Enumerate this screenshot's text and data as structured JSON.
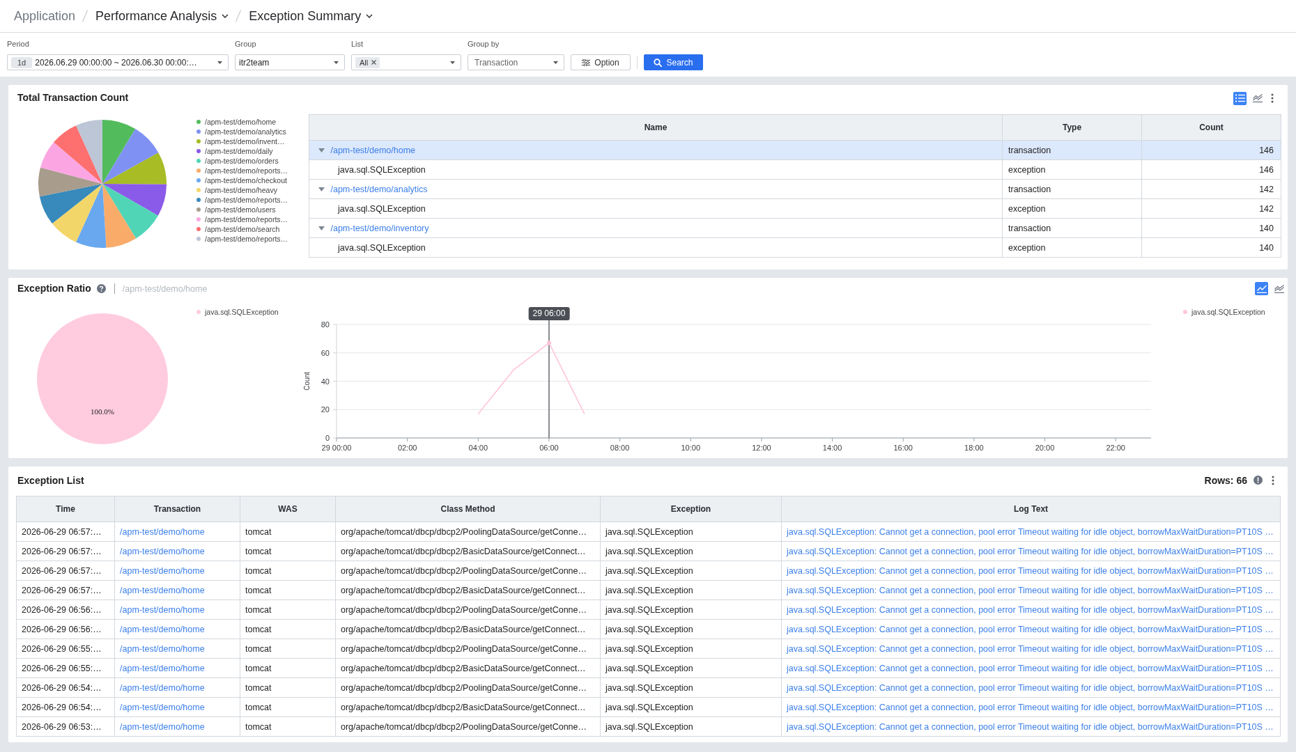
{
  "breadcrumb": [
    {
      "label": "Application",
      "dropdown": false
    },
    {
      "label": "Performance Analysis",
      "dropdown": true
    },
    {
      "label": "Exception Summary",
      "dropdown": true
    }
  ],
  "filters": {
    "period": {
      "label": "Period",
      "badge": "1d",
      "value": "2026.06.29 00:00:00 ~ 2026.06.30 00:00:…"
    },
    "group": {
      "label": "Group",
      "value": "itr2team"
    },
    "list": {
      "label": "List",
      "chips": [
        "All"
      ]
    },
    "group_by": {
      "label": "Group by",
      "value": "Transaction"
    },
    "option_button": {
      "label": "Option"
    },
    "search_button": {
      "label": "Search"
    }
  },
  "total_transaction_count": {
    "title": "Total Transaction Count",
    "view_buttons": [
      {
        "kind": "table",
        "selected": true
      },
      {
        "kind": "multi_line",
        "selected": false
      }
    ],
    "chart_data": {
      "type": "pie",
      "categories": [
        "/apm-test/demo/home",
        "/apm-test/demo/analytics",
        "/apm-test/demo/invent…",
        "/apm-test/demo/daily",
        "/apm-test/demo/orders",
        "/apm-test/demo/reports…",
        "/apm-test/demo/checkout",
        "/apm-test/demo/heavy",
        "/apm-test/demo/reports…",
        "/apm-test/demo/users",
        "/apm-test/demo/reports…",
        "/apm-test/demo/search",
        "/apm-test/demo/reports…"
      ],
      "values": [
        8.58,
        8.34,
        8.23,
        8.11,
        7.99,
        7.81,
        7.7,
        7.58,
        7.46,
        7.29,
        7.17,
        6.99,
        6.75
      ],
      "colors": [
        "#52bb5c",
        "#7f92f3",
        "#a8bc25",
        "#8a5ae8",
        "#50d5b7",
        "#f9ac69",
        "#69a8ef",
        "#f3d66a",
        "#378abb",
        "#a89c8c",
        "#fba6e3",
        "#fe6f6f",
        "#bcc6d6"
      ]
    },
    "table": {
      "columns": [
        "Name",
        "Type",
        "Count"
      ],
      "rows": [
        {
          "name": "/apm-test/demo/home",
          "type": "transaction",
          "count": "146",
          "selected": true,
          "expanded": true,
          "children": [
            {
              "name": "java.sql.SQLException",
              "type": "exception",
              "count": "146",
              "selected": false
            }
          ]
        },
        {
          "name": "/apm-test/demo/analytics",
          "type": "transaction",
          "count": "142",
          "selected": false,
          "expanded": true,
          "children": [
            {
              "name": "java.sql.SQLException",
              "type": "exception",
              "count": "142",
              "selected": false
            }
          ]
        },
        {
          "name": "/apm-test/demo/inventory",
          "type": "transaction",
          "count": "140",
          "selected": false,
          "expanded": true,
          "children": [
            {
              "name": "java.sql.SQLException",
              "type": "exception",
              "count": "140",
              "selected": false
            }
          ]
        }
      ]
    }
  },
  "exception_ratio": {
    "title": "Exception Ratio",
    "subtitle": "/apm-test/demo/home",
    "view_buttons": [
      {
        "kind": "line",
        "selected": true
      },
      {
        "kind": "multi_line",
        "selected": false
      }
    ],
    "ratio_pie": {
      "chart_data": {
        "type": "pie",
        "categories": [
          "java.sql.SQLException"
        ],
        "values": [
          100
        ],
        "colors": [
          "#ffccdf"
        ],
        "value_labels": [
          "100.0%"
        ]
      }
    },
    "trend_chart": {
      "chart_data": {
        "type": "line",
        "ylabel": "Count",
        "x": [
          4,
          5,
          6,
          7
        ],
        "xlim": [
          0,
          23
        ],
        "ylim": [
          0,
          80
        ],
        "xticks": [
          {
            "value": 0,
            "label": "29 00:00"
          },
          {
            "value": 2,
            "label": "02:00"
          },
          {
            "value": 4,
            "label": "04:00"
          },
          {
            "value": 6,
            "label": "06:00"
          },
          {
            "value": 8,
            "label": "08:00"
          },
          {
            "value": 10,
            "label": "10:00"
          },
          {
            "value": 12,
            "label": "12:00"
          },
          {
            "value": 14,
            "label": "14:00"
          },
          {
            "value": 16,
            "label": "16:00"
          },
          {
            "value": 18,
            "label": "18:00"
          },
          {
            "value": 20,
            "label": "20:00"
          },
          {
            "value": 22,
            "label": "22:00"
          }
        ],
        "yticks": [
          0,
          20,
          40,
          60,
          80
        ],
        "grid": true,
        "series": [
          {
            "name": "java.sql.SQLException",
            "color": "#ffc6da",
            "values": [
              17,
              48,
              67,
              17
            ]
          }
        ],
        "ref_lines": [
          {
            "axis": "x",
            "value": 6,
            "label": "29 06:00"
          }
        ]
      }
    }
  },
  "exception_list": {
    "title": "Exception List",
    "row_count": "Rows: 66",
    "columns": [
      {
        "label": "Time",
        "kind": "text"
      },
      {
        "label": "Transaction",
        "kind": "link"
      },
      {
        "label": "WAS",
        "kind": "text"
      },
      {
        "label": "Class Method",
        "kind": "text"
      },
      {
        "label": "Exception",
        "kind": "text"
      },
      {
        "label": "Log Text",
        "kind": "link"
      }
    ],
    "rows": [
      [
        "2026-06-29 06:57:…",
        "/apm-test/demo/home",
        "tomcat",
        "org/apache/tomcat/dbcp/dbcp2/PoolingDataSource/getConne…",
        "java.sql.SQLException",
        "java.sql.SQLException: Cannot get a connection, pool error Timeout waiting for idle object, borrowMaxWaitDuration=PT10S …"
      ],
      [
        "2026-06-29 06:57:…",
        "/apm-test/demo/home",
        "tomcat",
        "org/apache/tomcat/dbcp/dbcp2/BasicDataSource/getConnect…",
        "java.sql.SQLException",
        "java.sql.SQLException: Cannot get a connection, pool error Timeout waiting for idle object, borrowMaxWaitDuration=PT10S …"
      ],
      [
        "2026-06-29 06:57:…",
        "/apm-test/demo/home",
        "tomcat",
        "org/apache/tomcat/dbcp/dbcp2/PoolingDataSource/getConne…",
        "java.sql.SQLException",
        "java.sql.SQLException: Cannot get a connection, pool error Timeout waiting for idle object, borrowMaxWaitDuration=PT10S …"
      ],
      [
        "2026-06-29 06:57:…",
        "/apm-test/demo/home",
        "tomcat",
        "org/apache/tomcat/dbcp/dbcp2/BasicDataSource/getConnect…",
        "java.sql.SQLException",
        "java.sql.SQLException: Cannot get a connection, pool error Timeout waiting for idle object, borrowMaxWaitDuration=PT10S …"
      ],
      [
        "2026-06-29 06:56:…",
        "/apm-test/demo/home",
        "tomcat",
        "org/apache/tomcat/dbcp/dbcp2/PoolingDataSource/getConne…",
        "java.sql.SQLException",
        "java.sql.SQLException: Cannot get a connection, pool error Timeout waiting for idle object, borrowMaxWaitDuration=PT10S …"
      ],
      [
        "2026-06-29 06:56:…",
        "/apm-test/demo/home",
        "tomcat",
        "org/apache/tomcat/dbcp/dbcp2/BasicDataSource/getConnect…",
        "java.sql.SQLException",
        "java.sql.SQLException: Cannot get a connection, pool error Timeout waiting for idle object, borrowMaxWaitDuration=PT10S …"
      ],
      [
        "2026-06-29 06:55:…",
        "/apm-test/demo/home",
        "tomcat",
        "org/apache/tomcat/dbcp/dbcp2/PoolingDataSource/getConne…",
        "java.sql.SQLException",
        "java.sql.SQLException: Cannot get a connection, pool error Timeout waiting for idle object, borrowMaxWaitDuration=PT10S …"
      ],
      [
        "2026-06-29 06:55:…",
        "/apm-test/demo/home",
        "tomcat",
        "org/apache/tomcat/dbcp/dbcp2/BasicDataSource/getConnect…",
        "java.sql.SQLException",
        "java.sql.SQLException: Cannot get a connection, pool error Timeout waiting for idle object, borrowMaxWaitDuration=PT10S …"
      ],
      [
        "2026-06-29 06:54:…",
        "/apm-test/demo/home",
        "tomcat",
        "org/apache/tomcat/dbcp/dbcp2/PoolingDataSource/getConne…",
        "java.sql.SQLException",
        "java.sql.SQLException: Cannot get a connection, pool error Timeout waiting for idle object, borrowMaxWaitDuration=PT10S …"
      ],
      [
        "2026-06-29 06:54:…",
        "/apm-test/demo/home",
        "tomcat",
        "org/apache/tomcat/dbcp/dbcp2/BasicDataSource/getConnect…",
        "java.sql.SQLException",
        "java.sql.SQLException: Cannot get a connection, pool error Timeout waiting for idle object, borrowMaxWaitDuration=PT10S …"
      ],
      [
        "2026-06-29 06:53:…",
        "/apm-test/demo/home",
        "tomcat",
        "org/apache/tomcat/dbcp/dbcp2/PoolingDataSource/getConne…",
        "java.sql.SQLException",
        "java.sql.SQLException: Cannot get a connection, pool error Timeout waiting for idle object, borrowMaxWaitDuration=PT10S …"
      ]
    ]
  }
}
